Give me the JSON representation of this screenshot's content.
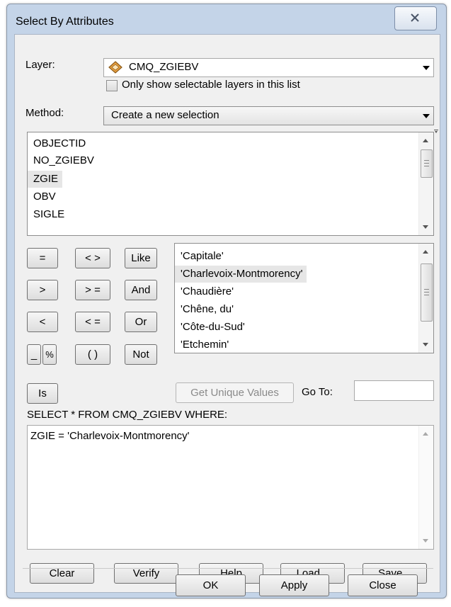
{
  "dialog": {
    "title": "Select By Attributes"
  },
  "layer": {
    "label": "Layer:",
    "value": "CMQ_ZGIEBV",
    "selectable_only_label": "Only show selectable layers in this list",
    "selectable_only_checked": false
  },
  "method": {
    "label": "Method:",
    "value": "Create a new selection"
  },
  "fields": {
    "items": [
      "OBJECTID",
      "NO_ZGIEBV",
      "ZGIE",
      "OBV",
      "SIGLE"
    ],
    "selected": "ZGIE"
  },
  "operators": {
    "eq": "=",
    "ne": "< >",
    "like": "Like",
    "gt": ">",
    "ge": "> =",
    "and": "And",
    "lt": "<",
    "le": "< =",
    "or": "Or",
    "underscore": "_",
    "percent": "%",
    "parens": "( )",
    "not": "Not",
    "is": "Is"
  },
  "values": {
    "items": [
      "'Capitale'",
      "'Charlevoix-Montmorency'",
      "'Chaudière'",
      "'Chêne, du'",
      "'Côte-du-Sud'",
      "'Etchemin'"
    ],
    "selected": "'Charlevoix-Montmorency'"
  },
  "unique": {
    "get_unique_label": "Get Unique Values",
    "goto_label": "Go To:",
    "goto_value": ""
  },
  "query": {
    "header": "SELECT * FROM CMQ_ZGIEBV WHERE:",
    "expression": "ZGIE = 'Charlevoix-Montmorency'"
  },
  "query_buttons": {
    "clear": "Clear",
    "verify": "Verify",
    "help": "Help",
    "load": "Load...",
    "save": "Save..."
  },
  "footer": {
    "ok": "OK",
    "apply": "Apply",
    "close": "Close"
  },
  "icons": {
    "layer_icon": "layer-diamond-icon",
    "close_icon": "close-x-icon"
  },
  "colors": {
    "window_frame": "#c4d4e8",
    "client_bg": "#f0f0f0",
    "selection_bg": "#e6e6e6",
    "layer_icon_fill": "#e8a040"
  }
}
